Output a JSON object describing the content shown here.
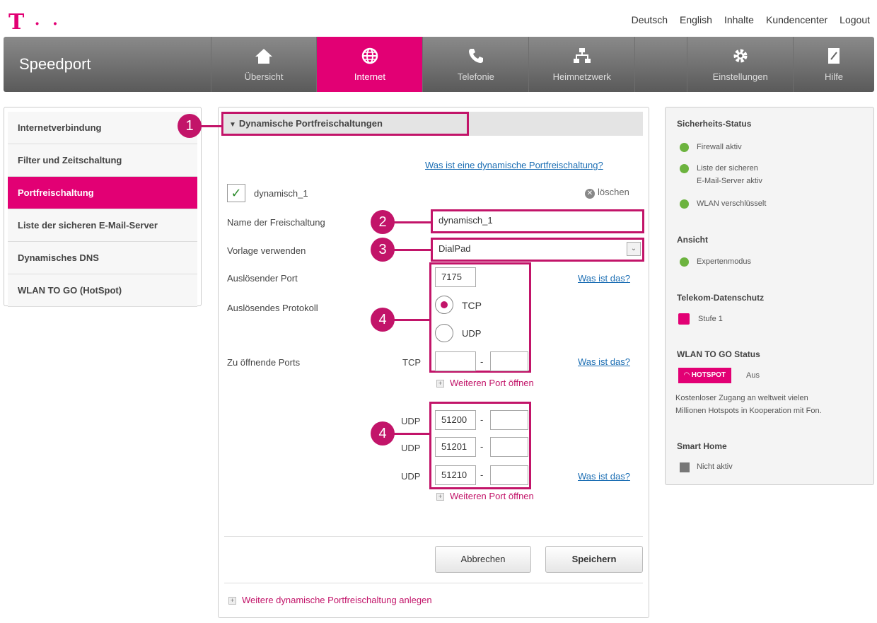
{
  "logo": {
    "t": "T",
    "dots": "· ·"
  },
  "topnav": [
    "Deutsch",
    "English",
    "Inhalte",
    "Kundencenter",
    "Logout"
  ],
  "brand": "Speedport",
  "nav": [
    {
      "label": "Übersicht",
      "icon": "home-icon"
    },
    {
      "label": "Internet",
      "icon": "globe-icon"
    },
    {
      "label": "Telefonie",
      "icon": "phone-icon"
    },
    {
      "label": "Heimnetzwerk",
      "icon": "network-icon"
    },
    {
      "label": "Einstellungen",
      "icon": "gear-icon"
    },
    {
      "label": "Hilfe",
      "icon": "help-icon"
    }
  ],
  "sidebar": [
    "Internetverbindung",
    "Filter und Zeitschaltung",
    "Portfreischaltung",
    "Liste der sicheren E-Mail-Server",
    "Dynamisches DNS",
    "WLAN TO GO (HotSpot)"
  ],
  "section": {
    "title": "Dynamische Portfreischaltungen",
    "help": "Was ist eine dynamische Portfreischaltung?",
    "rule_name": "dynamisch_1",
    "delete": "löschen",
    "name_label": "Name der Freischaltung",
    "name_value": "dynamisch_1",
    "template_label": "Vorlage verwenden",
    "template_value": "DialPad",
    "trigger_port_label": "Auslösender Port",
    "trigger_port_value": "7175",
    "what_is": "Was ist das?",
    "protocol_label": "Auslösendes Protokoll",
    "tcp": "TCP",
    "udp": "UDP",
    "open_ports_label": "Zu öffnende Ports",
    "tcp_ports": {
      "proto": "TCP",
      "from": "",
      "to": ""
    },
    "udp_ports": [
      {
        "proto": "UDP",
        "from": "51200",
        "to": ""
      },
      {
        "proto": "UDP",
        "from": "51201",
        "to": ""
      },
      {
        "proto": "UDP",
        "from": "51210",
        "to": ""
      }
    ],
    "dash": "-",
    "more_port": "Weiteren Port öffnen",
    "cancel": "Abbrechen",
    "save": "Speichern",
    "add_rule": "Weitere dynamische Portfreischaltung anlegen"
  },
  "badges": {
    "b1": "1",
    "b2": "2",
    "b3": "3",
    "b4": "4"
  },
  "right": {
    "security_title": "Sicherheits-Status",
    "firewall": "Firewall aktiv",
    "mail_list": "Liste der sicheren",
    "mail_list2": "E-Mail-Server aktiv",
    "wlan": "WLAN verschlüsselt",
    "view_title": "Ansicht",
    "expert": "Expertenmodus",
    "privacy_title": "Telekom-Datenschutz",
    "privacy_level": "Stufe 1",
    "wlantogo_title": "WLAN TO GO Status",
    "hotspot": "HOTSPOT",
    "hotspot_state": "Aus",
    "hotspot_desc1": "Kostenloser Zugang an weltweit vielen",
    "hotspot_desc2": "Millionen Hotspots in Kooperation mit Fon.",
    "smarthome_title": "Smart Home",
    "smarthome_state": "Nicht aktiv"
  },
  "colors": {
    "magenta": "#e20074",
    "highlight": "#c21469",
    "bar": "#6e6e6e",
    "green": "#6cb33e"
  }
}
